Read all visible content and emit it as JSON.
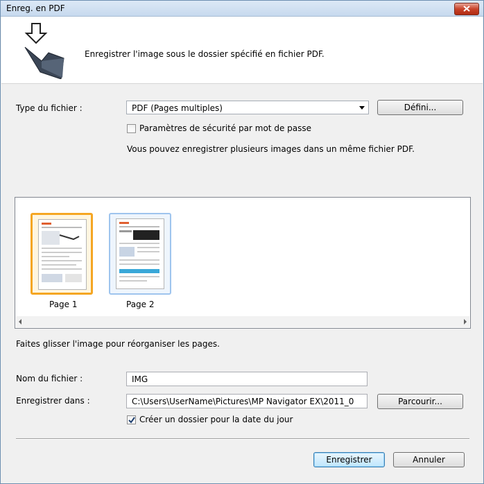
{
  "window": {
    "title": "Enreg. en PDF"
  },
  "header": {
    "description": "Enregistrer l'image sous le dossier spécifié en fichier PDF."
  },
  "file_type": {
    "label": "Type du fichier :",
    "selected": "PDF (Pages multiples)",
    "define_button": "Défini..."
  },
  "security": {
    "label": "Paramètres de sécurité par mot de passe",
    "checked": false
  },
  "info_text": "Vous pouvez enregistrer plusieurs images dans un même fichier PDF.",
  "pages": [
    {
      "label": "Page 1",
      "selected": true
    },
    {
      "label": "Page 2",
      "selected": false
    }
  ],
  "drag_hint": "Faites glisser l'image pour réorganiser les pages.",
  "file_name": {
    "label": "Nom du fichier :",
    "value": "IMG"
  },
  "save_in": {
    "label": "Enregistrer dans :",
    "value": "C:\\Users\\UserName\\Pictures\\MP Navigator EX\\2011_0",
    "browse_button": "Parcourir..."
  },
  "date_folder": {
    "label": "Créer un dossier pour la date du jour",
    "checked": true
  },
  "buttons": {
    "save": "Enregistrer",
    "cancel": "Annuler"
  }
}
